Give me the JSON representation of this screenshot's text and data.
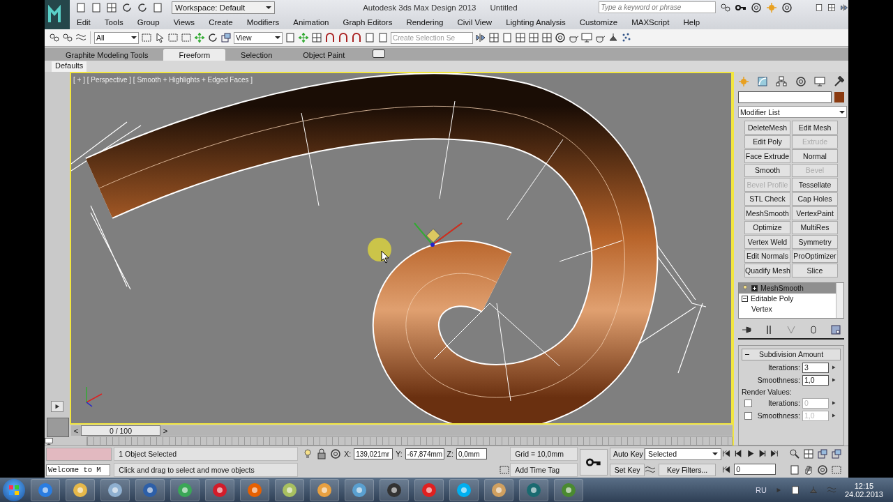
{
  "title_bar": {
    "workspace": "Workspace: Default",
    "app_title": "Autodesk 3ds Max Design 2013",
    "document": "Untitled",
    "search": {
      "placeholder": "Type a keyword or phrase"
    }
  },
  "menu": [
    "Edit",
    "Tools",
    "Group",
    "Views",
    "Create",
    "Modifiers",
    "Animation",
    "Graph Editors",
    "Rendering",
    "Civil View",
    "Lighting Analysis",
    "Customize",
    "MAXScript",
    "Help"
  ],
  "main_toolbar": {
    "selection_filter": "All",
    "reference_coord": "View",
    "selection_set": {
      "placeholder": "Create Selection Se"
    }
  },
  "ribbon_tabs": [
    {
      "label": "Graphite Modeling Tools",
      "selected": false
    },
    {
      "label": "Freeform",
      "selected": true
    },
    {
      "label": "Selection",
      "selected": false
    },
    {
      "label": "Object Paint",
      "selected": false
    }
  ],
  "ribbon_panel": "Defaults",
  "viewport": {
    "label": "[ + ] [ Perspective ] [ Smooth + Highlights + Edged Faces ]"
  },
  "command_panel": {
    "modifier_list": "Modifier List",
    "modifier_buttons": [
      {
        "label": "DeleteMesh",
        "disabled": false
      },
      {
        "label": "Edit Mesh",
        "disabled": false
      },
      {
        "label": "Edit Poly",
        "disabled": false
      },
      {
        "label": "Extrude",
        "disabled": true
      },
      {
        "label": "Face Extrude",
        "disabled": false
      },
      {
        "label": "Normal",
        "disabled": false
      },
      {
        "label": "Smooth",
        "disabled": false
      },
      {
        "label": "Bevel",
        "disabled": true
      },
      {
        "label": "Bevel Profile",
        "disabled": true
      },
      {
        "label": "Tessellate",
        "disabled": false
      },
      {
        "label": "STL Check",
        "disabled": false
      },
      {
        "label": "Cap Holes",
        "disabled": false
      },
      {
        "label": "MeshSmooth",
        "disabled": false
      },
      {
        "label": "VertexPaint",
        "disabled": false
      },
      {
        "label": "Optimize",
        "disabled": false
      },
      {
        "label": "MultiRes",
        "disabled": false
      },
      {
        "label": "Vertex Weld",
        "disabled": false
      },
      {
        "label": "Symmetry",
        "disabled": false
      },
      {
        "label": "Edit Normals",
        "disabled": false
      },
      {
        "label": "ProOptimizer",
        "disabled": false
      },
      {
        "label": "Quadify Mesh",
        "disabled": false
      },
      {
        "label": "Slice",
        "disabled": false
      }
    ],
    "stack": [
      {
        "label": "MeshSmooth",
        "selected": true,
        "expanded": false
      },
      {
        "label": "Editable Poly",
        "selected": false,
        "expanded": true,
        "children": [
          {
            "label": "Vertex",
            "selected": false
          }
        ]
      }
    ],
    "rollout": {
      "title": "Subdivision Amount",
      "iterations": {
        "label": "Iterations:",
        "value": "3"
      },
      "smoothness": {
        "label": "Smoothness:",
        "value": "1,0"
      },
      "render_values": "Render Values:",
      "render_iterations": {
        "label": "Iterations:",
        "value": "0",
        "checked": false,
        "disabled": true
      },
      "render_smoothness": {
        "label": "Smoothness:",
        "value": "1,0",
        "checked": false,
        "disabled": true
      }
    }
  },
  "time_slider": {
    "position": "0 / 100",
    "prev": "<",
    "next": ">"
  },
  "status": {
    "listener": "Welcome to M",
    "selection": "1 Object Selected",
    "prompt": "Click and drag to select and move objects",
    "x_label": "X:",
    "x": "139,021mr",
    "y_label": "Y:",
    "y": "-67,874mm",
    "z_label": "Z:",
    "z": "0,0mm",
    "grid": "Grid = 10,0mm",
    "time_tag": "Add Time Tag"
  },
  "animation": {
    "auto_key": "Auto Key",
    "set_key": "Set Key",
    "key_mode": "Selected",
    "key_filters": "Key Filters...",
    "frame": "0"
  },
  "taskbar": {
    "language": "RU",
    "time": "12:15",
    "date": "24.02.2013"
  }
}
